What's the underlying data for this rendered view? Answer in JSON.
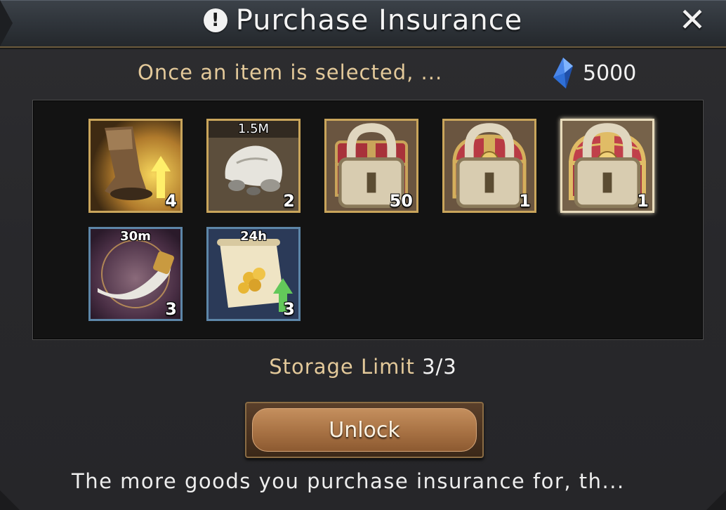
{
  "header": {
    "title": "Purchase Insurance",
    "close_label": "✕"
  },
  "info": {
    "subtitle": "Once an item is selected, ...",
    "gem_count": "5000"
  },
  "items": [
    {
      "name": "speed-boost-boot",
      "top_label": "",
      "quantity": "4",
      "frame": "gold",
      "locked": false,
      "selected": false
    },
    {
      "name": "silver-ore-sack",
      "top_label": "1.5M",
      "quantity": "2",
      "frame": "gold",
      "locked": false,
      "selected": false
    },
    {
      "name": "red-chest-common",
      "top_label": "",
      "quantity": "50",
      "frame": "gold",
      "locked": true,
      "selected": false
    },
    {
      "name": "red-chest-golden",
      "top_label": "",
      "quantity": "1",
      "frame": "gold",
      "locked": true,
      "selected": false
    },
    {
      "name": "red-chest-ornate",
      "top_label": "",
      "quantity": "1",
      "frame": "gold",
      "locked": true,
      "selected": true
    },
    {
      "name": "war-horn",
      "top_label": "30m",
      "quantity": "3",
      "frame": "blue",
      "locked": false,
      "selected": false
    },
    {
      "name": "gold-scroll-boost",
      "top_label": "24h",
      "quantity": "3",
      "frame": "blue",
      "locked": false,
      "selected": false
    }
  ],
  "storage": {
    "label": "Storage Limit",
    "value": "3/3"
  },
  "actions": {
    "unlock_label": "Unlock"
  },
  "footer": {
    "text": "The more goods you purchase insurance for, th..."
  },
  "colors": {
    "accent_gold": "#c9a55b",
    "text_gold": "#e3c99a",
    "frame_blue": "#5d86a8",
    "button_brown": "#ad7748"
  }
}
